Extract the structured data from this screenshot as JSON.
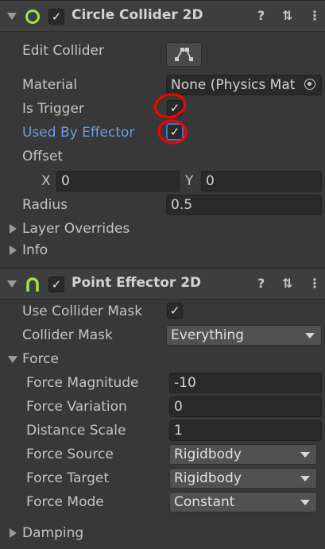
{
  "circle_collider": {
    "title": "Circle Collider 2D",
    "enabled": true,
    "edit_collider_label": "Edit Collider",
    "material_label": "Material",
    "material_value": "None (Physics Mat",
    "is_trigger_label": "Is Trigger",
    "is_trigger": true,
    "used_by_effector_label": "Used By Effector",
    "used_by_effector": true,
    "offset_label": "Offset",
    "offset_x_label": "X",
    "offset_x": "0",
    "offset_y_label": "Y",
    "offset_y": "0",
    "radius_label": "Radius",
    "radius": "0.5",
    "layer_overrides_label": "Layer Overrides",
    "info_label": "Info"
  },
  "point_effector": {
    "title": "Point Effector 2D",
    "enabled": true,
    "use_collider_mask_label": "Use Collider Mask",
    "use_collider_mask": true,
    "collider_mask_label": "Collider Mask",
    "collider_mask_value": "Everything",
    "force_label": "Force",
    "force_magnitude_label": "Force Magnitude",
    "force_magnitude": "-10",
    "force_variation_label": "Force Variation",
    "force_variation": "0",
    "distance_scale_label": "Distance Scale",
    "distance_scale": "1",
    "force_source_label": "Force Source",
    "force_source": "Rigidbody",
    "force_target_label": "Force Target",
    "force_target": "Rigidbody",
    "force_mode_label": "Force Mode",
    "force_mode": "Constant",
    "damping_label": "Damping"
  },
  "header_icons": {
    "help": "?",
    "presets": "⇅",
    "menu": "⋮"
  },
  "check_glyph": "✓",
  "colors": {
    "background": "#383838",
    "header": "#3e3e3e",
    "accent_blue": "#6a9ee6",
    "annotation_red": "#ff0000",
    "collider_icon_green": "#9fe34a"
  }
}
